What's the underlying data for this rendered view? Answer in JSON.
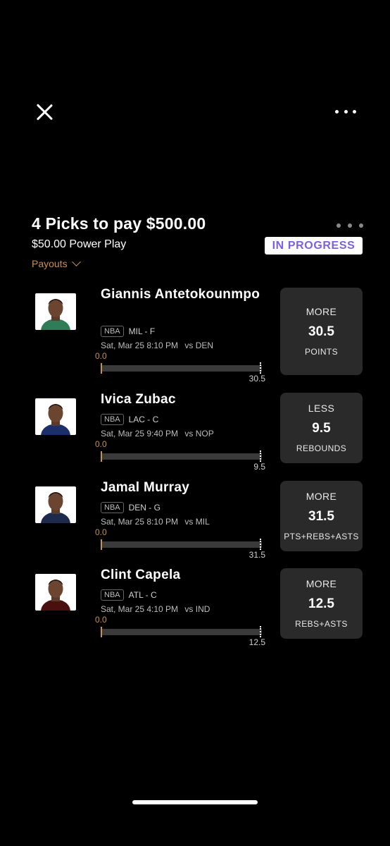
{
  "header": {
    "close_icon": "close-icon",
    "more_icon": "more-horizontal-icon"
  },
  "entry": {
    "title": "4 Picks to pay $500.00",
    "subtitle": "$50.00 Power Play",
    "payouts_label": "Payouts",
    "status": "IN PROGRESS"
  },
  "colors": {
    "accent": "#c9914f",
    "status_text": "#7b5fe6",
    "card_bg": "#2a2a2a"
  },
  "picks": [
    {
      "name": "Giannis Antetokounmpo",
      "league": "NBA",
      "team_pos": "MIL - F",
      "game": "Sat, Mar 25 8:10 PM",
      "opponent": "vs DEN",
      "current": "0.0",
      "line_label": "30.5",
      "direction": "MORE",
      "line": "30.5",
      "stat": "POINTS",
      "jersey": "#2e7d57"
    },
    {
      "name": "Ivica Zubac",
      "league": "NBA",
      "team_pos": "LAC - C",
      "game": "Sat, Mar 25 9:40 PM",
      "opponent": "vs NOP",
      "current": "0.0",
      "line_label": "9.5",
      "direction": "LESS",
      "line": "9.5",
      "stat": "REBOUNDS",
      "jersey": "#1d2f6b"
    },
    {
      "name": "Jamal Murray",
      "league": "NBA",
      "team_pos": "DEN - G",
      "game": "Sat, Mar 25 8:10 PM",
      "opponent": "vs MIL",
      "current": "0.0",
      "line_label": "31.5",
      "direction": "MORE",
      "line": "31.5",
      "stat": "PTS+REBS+ASTS",
      "jersey": "#1c2a4e"
    },
    {
      "name": "Clint Capela",
      "league": "NBA",
      "team_pos": "ATL - C",
      "game": "Sat, Mar 25 4:10 PM",
      "opponent": "vs IND",
      "current": "0.0",
      "line_label": "12.5",
      "direction": "MORE",
      "line": "12.5",
      "stat": "REBS+ASTS",
      "jersey": "#4a1010"
    }
  ]
}
